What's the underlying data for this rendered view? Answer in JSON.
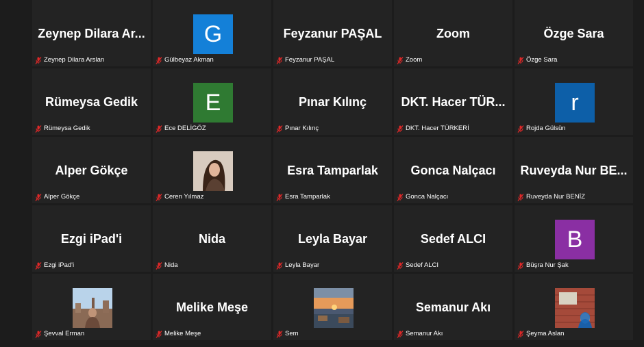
{
  "colors": {
    "mic_muted": "#e02828",
    "avatar_g": "#1480d8",
    "avatar_e": "#2f7a32",
    "avatar_r": "#0d5fa8",
    "avatar_b": "#8a2fa3"
  },
  "participants": [
    {
      "display": "Zeynep Dilara Ar...",
      "name": "Zeynep Dilara Arslan",
      "type": "text"
    },
    {
      "display": "G",
      "name": "Gülbeyaz Akman",
      "type": "avatar",
      "color": "#1480d8"
    },
    {
      "display": "Feyzanur PAŞAL",
      "name": "Feyzanur PAŞAL",
      "type": "text"
    },
    {
      "display": "Zoom",
      "name": "Zoom",
      "type": "text"
    },
    {
      "display": "Özge Sara",
      "name": "Özge Sara",
      "type": "text"
    },
    {
      "display": "Rümeysa Gedik",
      "name": "Rümeysa Gedik",
      "type": "text"
    },
    {
      "display": "E",
      "name": "Ece DELİGÖZ",
      "type": "avatar",
      "color": "#2f7a32"
    },
    {
      "display": "Pınar Kılınç",
      "name": "Pınar Kılınç",
      "type": "text"
    },
    {
      "display": "DKT. Hacer TÜR...",
      "name": "DKT. Hacer TÜRKERİ",
      "type": "text"
    },
    {
      "display": "r",
      "name": "Rojda Gülsün",
      "type": "avatar",
      "color": "#0d5fa8"
    },
    {
      "display": "Alper Gökçe",
      "name": "Alper Gökçe",
      "type": "text"
    },
    {
      "display": "",
      "name": "Ceren Yılmaz",
      "type": "photo",
      "photo": "portrait"
    },
    {
      "display": "Esra Tamparlak",
      "name": "Esra Tamparlak",
      "type": "text"
    },
    {
      "display": "Gonca Nalçacı",
      "name": "Gonca Nalçacı",
      "type": "text"
    },
    {
      "display": "Ruveyda Nur BE...",
      "name": "Ruveyda Nur BENİZ",
      "type": "text"
    },
    {
      "display": "Ezgi iPad'i",
      "name": "Ezgi iPad'i",
      "type": "text"
    },
    {
      "display": "Nida",
      "name": "Nida",
      "type": "text"
    },
    {
      "display": "Leyla Bayar",
      "name": "Leyla Bayar",
      "type": "text"
    },
    {
      "display": "Sedef ALCI",
      "name": "Sedef ALCI",
      "type": "text"
    },
    {
      "display": "B",
      "name": "Büşra Nur Şak",
      "type": "avatar",
      "color": "#8a2fa3"
    },
    {
      "display": "",
      "name": "Şevval Erman",
      "type": "photo",
      "photo": "city"
    },
    {
      "display": "Melike Meşe",
      "name": "Melike Meşe",
      "type": "text"
    },
    {
      "display": "",
      "name": "Sem",
      "type": "photo",
      "photo": "sunset"
    },
    {
      "display": "Semanur Akı",
      "name": "Semanur Akı",
      "type": "text"
    },
    {
      "display": "",
      "name": "Şeyma Aslan",
      "type": "photo",
      "photo": "wall"
    }
  ]
}
